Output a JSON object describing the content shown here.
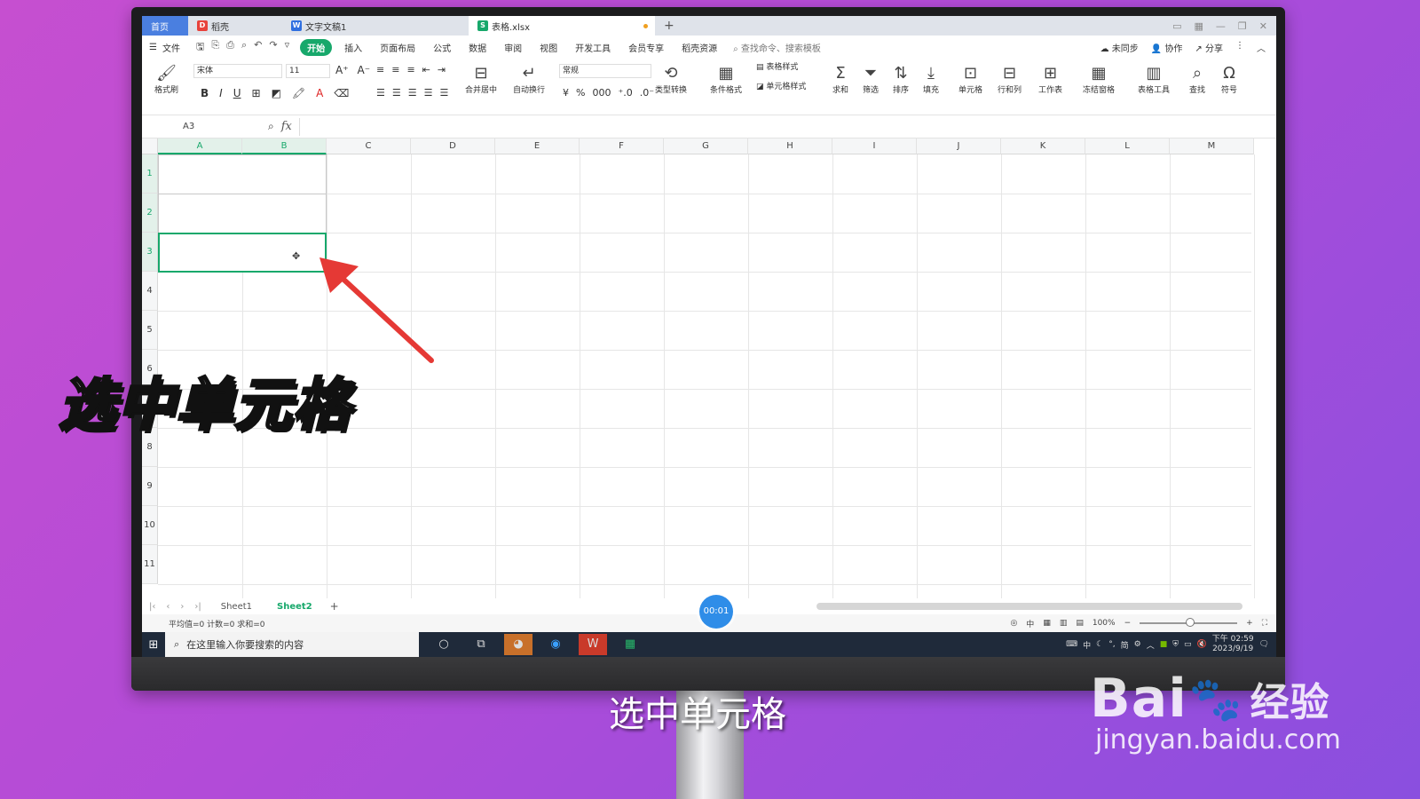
{
  "tabs": [
    {
      "label": "首页"
    },
    {
      "label": "稻壳"
    },
    {
      "label": "文字文稿1"
    },
    {
      "label": "表格.xlsx"
    }
  ],
  "menu": {
    "file": "文件",
    "items": [
      "开始",
      "插入",
      "页面布局",
      "公式",
      "数据",
      "审阅",
      "视图",
      "开发工具",
      "会员专享",
      "稻壳资源"
    ],
    "search_cmd": "查找命令、搜索模板",
    "right": [
      "未同步",
      "协作",
      "分享"
    ]
  },
  "ribbon": {
    "format_painter": "格式刷",
    "font_name": "宋体",
    "font_size": "11",
    "merge_center": "合并居中",
    "wrap_text": "自动换行",
    "number_format": "常规",
    "type_convert": "类型转换",
    "cond_format": "条件格式",
    "table_style": "表格样式",
    "cell_style": "单元格样式",
    "sum": "求和",
    "filter": "筛选",
    "sort": "排序",
    "fill": "填充",
    "cell": "单元格",
    "row_col": "行和列",
    "worksheet": "工作表",
    "freeze": "冻结窗格",
    "table_tools": "表格工具",
    "find": "查找",
    "symbol": "符号"
  },
  "formula_bar": {
    "name_box": "A3",
    "fx": "fx"
  },
  "grid": {
    "columns": [
      "A",
      "B",
      "C",
      "D",
      "E",
      "F",
      "G",
      "H",
      "I",
      "J",
      "K",
      "L",
      "M"
    ],
    "rows": [
      "1",
      "2",
      "3",
      "4",
      "5",
      "6",
      "7",
      "8",
      "9",
      "10",
      "11"
    ]
  },
  "sheets": {
    "tabs": [
      "Sheet1",
      "Sheet2"
    ],
    "active": "Sheet2",
    "add": "+"
  },
  "status": {
    "stats": "平均值=0  计数=0  求和=0",
    "zoom": "100%"
  },
  "taskbar": {
    "search_placeholder": "在这里输入你要搜索的内容",
    "time": "下午 02:59",
    "date": "2023/9/19",
    "ime": "中",
    "lang": "简"
  },
  "timer": "00:01",
  "overlay": {
    "caption": "选中单元格",
    "subtitle": "选中单元格"
  },
  "watermark": {
    "brand": "Bai",
    "brand2": "经验",
    "url": "jingyan.baidu.com"
  },
  "colors": {
    "accent": "#17a86b",
    "timer": "#2f8de8",
    "arrow": "#e53935",
    "background": "#c64fd0"
  }
}
